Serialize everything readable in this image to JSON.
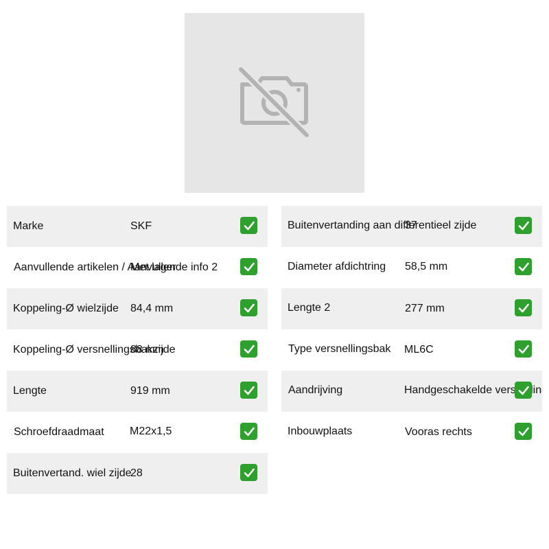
{
  "product_image": {
    "icon": "no-camera-icon"
  },
  "left_table": [
    {
      "label": "Marke",
      "value": "SKF"
    },
    {
      "label": "Aanvullende artikelen / Aanvullende info 2",
      "value": "Met lager"
    },
    {
      "label": "Koppeling-Ø wielzijde",
      "value": "84,4 mm"
    },
    {
      "label": "Koppeling-Ø versnellingsbakzijde",
      "value": "88 mm"
    },
    {
      "label": "Lengte",
      "value": "919 mm"
    },
    {
      "label": "Schroefdraadmaat",
      "value": "M22x1,5"
    },
    {
      "label": "Buitenvertand. wiel zijde",
      "value": "28"
    }
  ],
  "right_table": [
    {
      "label": "Buitenvertanding aan differentieel zijde",
      "value": "37"
    },
    {
      "label": "Diameter afdichtring",
      "value": "58,5 mm"
    },
    {
      "label": "Lengte 2",
      "value": "277 mm"
    },
    {
      "label": "Type versnellingsbak",
      "value": "ML6C"
    },
    {
      "label": "Aandrijving",
      "value": "Handgeschakelde versnellingsbak"
    },
    {
      "label": "Inbouwplaats",
      "value": "Vooras rechts"
    }
  ],
  "check_icon": "check-mark-icon",
  "colors": {
    "row_shade": "#efefef",
    "check_green": "#2ea02e",
    "image_bg": "#e6e6e6",
    "icon_gray": "#b3b3b3"
  }
}
